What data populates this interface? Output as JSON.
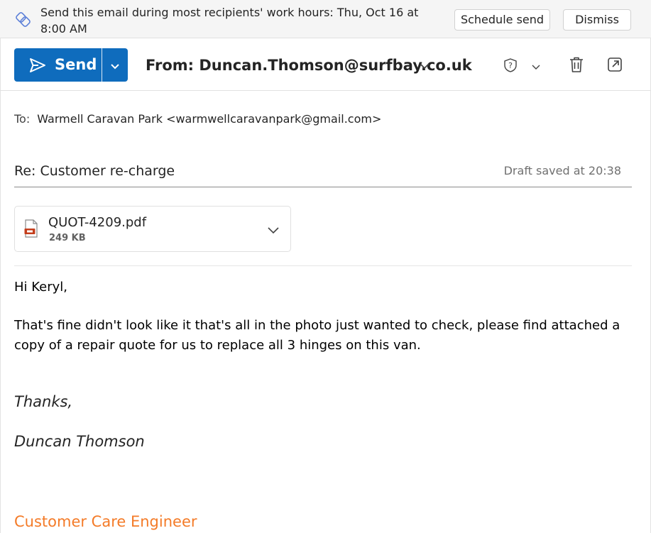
{
  "banner": {
    "message": "Send this email during most recipients' work hours: Thu, Oct 16 at 8:00 AM",
    "schedule_label": "Schedule send",
    "dismiss_label": "Dismiss",
    "icon": "schedule-icon"
  },
  "toolbar": {
    "send_label": "Send",
    "from_text": "From: Duncan.Thomson@surfbay.co.uk",
    "icons": [
      "send-arrow-icon",
      "chevron-down-icon",
      "sensitivity-icon",
      "chevron-down-icon",
      "trash-icon",
      "pop-out-icon"
    ]
  },
  "compose": {
    "to_label": "To:",
    "to_value": "Warmell Caravan Park <warmwellcaravanpark@gmail.com>",
    "subject": "Re: Customer re-charge",
    "draft_status": "Draft saved at 20:38"
  },
  "attachment": {
    "name": "QUOT-4209.pdf",
    "size": "249 KB",
    "icon": "pdf-file-icon"
  },
  "body": {
    "greeting": "Hi Keryl,",
    "paragraph": "That's fine didn't look like it that's all in the photo just wanted to check, please find attached a copy of a repair quote for us to replace all 3 hinges on this van.",
    "signoff": "Thanks,",
    "signature_name": "Duncan Thomson",
    "signature_role": "Customer Care Engineer"
  },
  "colors": {
    "accent": "#0f6cbd",
    "role_text": "#f47b28",
    "banner_bg": "#f5f5f5"
  }
}
